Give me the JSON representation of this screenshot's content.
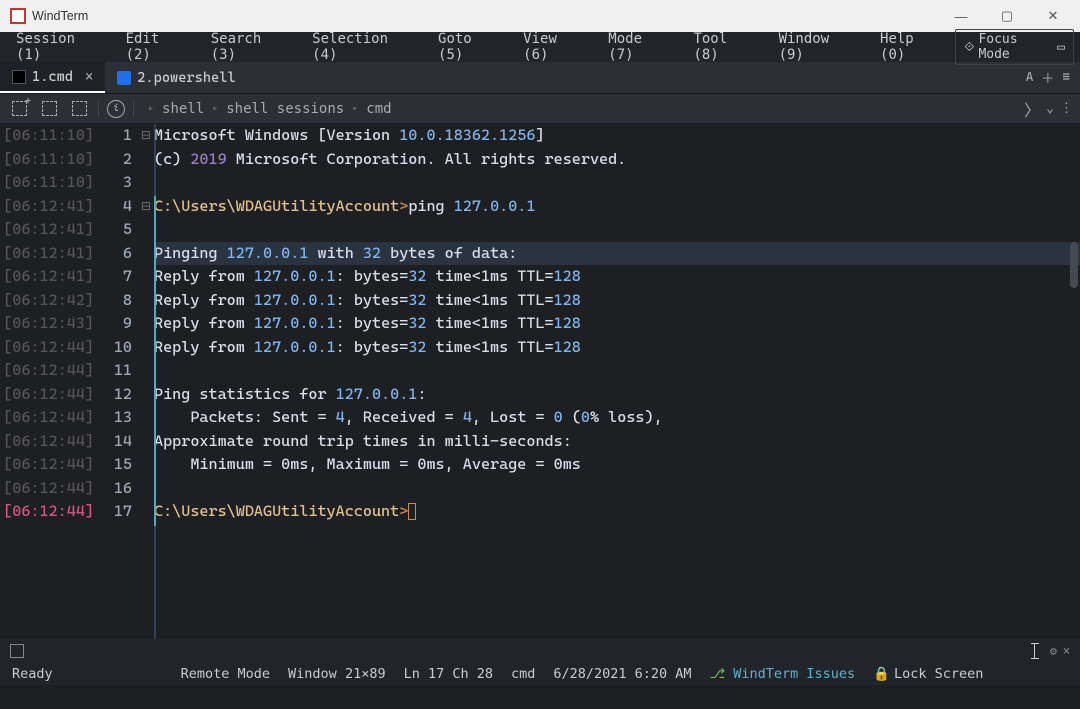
{
  "titlebar": {
    "title": "WindTerm"
  },
  "menu": {
    "session": "Session (1)",
    "edit": "Edit (2)",
    "search": "Search (3)",
    "selection": "Selection (4)",
    "goto": "Goto (5)",
    "view": "View (6)",
    "mode": "Mode (7)",
    "tool": "Tool (8)",
    "window": "Window (9)",
    "help": "Help (0)",
    "focusmode": "Focus Mode"
  },
  "tabs": {
    "t1": "1.cmd",
    "t2": "2.powershell",
    "aa": "A"
  },
  "crumbs": {
    "a": "shell",
    "b": "shell sessions",
    "c": "cmd"
  },
  "lines": [
    {
      "ts": "[06:11:10]",
      "n": "1",
      "fold": "⊟",
      "seg": [
        [
          "kw",
          "Microsoft Windows [Version "
        ],
        [
          "ver",
          "10.0.18362.1256"
        ],
        [
          "kw",
          "]"
        ]
      ]
    },
    {
      "ts": "[06:11:10]",
      "n": "2",
      "fold": "",
      "seg": [
        [
          "kw",
          "(c) "
        ],
        [
          "year",
          "2019"
        ],
        [
          "kw",
          " Microsoft Corporation. All rights reserved."
        ]
      ]
    },
    {
      "ts": "[06:11:10]",
      "n": "3",
      "fold": "",
      "seg": []
    },
    {
      "ts": "[06:12:41]",
      "n": "4",
      "fold": "⊟",
      "seg": [
        [
          "path",
          "C:\\Users\\WDAGUtilityAccount"
        ],
        [
          "op",
          ">"
        ],
        [
          "kw",
          "ping "
        ],
        [
          "ip",
          "127.0.0.1"
        ]
      ]
    },
    {
      "ts": "[06:12:41]",
      "n": "5",
      "fold": "",
      "seg": []
    },
    {
      "ts": "[06:12:41]",
      "n": "6",
      "fold": "",
      "hl": true,
      "seg": [
        [
          "kw",
          "Pinging "
        ],
        [
          "ip",
          "127.0.0.1"
        ],
        [
          "kw",
          " with "
        ],
        [
          "num",
          "32"
        ],
        [
          "kw",
          " bytes of data:"
        ]
      ]
    },
    {
      "ts": "[06:12:41]",
      "n": "7",
      "fold": "",
      "seg": [
        [
          "kw",
          "Reply from "
        ],
        [
          "ip",
          "127.0.0.1"
        ],
        [
          "kw",
          ": bytes="
        ],
        [
          "num",
          "32"
        ],
        [
          "kw",
          " time<1ms TTL="
        ],
        [
          "num",
          "128"
        ]
      ]
    },
    {
      "ts": "[06:12:42]",
      "n": "8",
      "fold": "",
      "seg": [
        [
          "kw",
          "Reply from "
        ],
        [
          "ip",
          "127.0.0.1"
        ],
        [
          "kw",
          ": bytes="
        ],
        [
          "num",
          "32"
        ],
        [
          "kw",
          " time<1ms TTL="
        ],
        [
          "num",
          "128"
        ]
      ]
    },
    {
      "ts": "[06:12:43]",
      "n": "9",
      "fold": "",
      "seg": [
        [
          "kw",
          "Reply from "
        ],
        [
          "ip",
          "127.0.0.1"
        ],
        [
          "kw",
          ": bytes="
        ],
        [
          "num",
          "32"
        ],
        [
          "kw",
          " time<1ms TTL="
        ],
        [
          "num",
          "128"
        ]
      ]
    },
    {
      "ts": "[06:12:44]",
      "n": "10",
      "fold": "",
      "seg": [
        [
          "kw",
          "Reply from "
        ],
        [
          "ip",
          "127.0.0.1"
        ],
        [
          "kw",
          ": bytes="
        ],
        [
          "num",
          "32"
        ],
        [
          "kw",
          " time<1ms TTL="
        ],
        [
          "num",
          "128"
        ]
      ]
    },
    {
      "ts": "[06:12:44]",
      "n": "11",
      "fold": "",
      "seg": []
    },
    {
      "ts": "[06:12:44]",
      "n": "12",
      "fold": "",
      "seg": [
        [
          "kw",
          "Ping statistics for "
        ],
        [
          "ip",
          "127.0.0.1"
        ],
        [
          "kw",
          ":"
        ]
      ]
    },
    {
      "ts": "[06:12:44]",
      "n": "13",
      "fold": "",
      "seg": [
        [
          "kw",
          "    Packets: Sent = "
        ],
        [
          "num",
          "4"
        ],
        [
          "kw",
          ", Received = "
        ],
        [
          "num",
          "4"
        ],
        [
          "kw",
          ", Lost = "
        ],
        [
          "num",
          "0"
        ],
        [
          "kw",
          " ("
        ],
        [
          "num",
          "0"
        ],
        [
          "kw",
          "% loss),"
        ]
      ]
    },
    {
      "ts": "[06:12:44]",
      "n": "14",
      "fold": "",
      "seg": [
        [
          "kw",
          "Approximate round trip times in milli-seconds:"
        ]
      ]
    },
    {
      "ts": "[06:12:44]",
      "n": "15",
      "fold": "",
      "seg": [
        [
          "kw",
          "    Minimum = 0ms, Maximum = 0ms, Average = 0ms"
        ]
      ]
    },
    {
      "ts": "[06:12:44]",
      "n": "16",
      "fold": "",
      "seg": []
    },
    {
      "ts": "[06:12:44]",
      "n": "17",
      "fold": "",
      "hot": true,
      "seg": [
        [
          "path",
          "C:\\Users\\WDAGUtilityAccount"
        ],
        [
          "op",
          ">"
        ],
        [
          "cursor",
          ""
        ]
      ]
    }
  ],
  "status": {
    "ready": "Ready",
    "mode": "Remote Mode",
    "win": "Window 21×89",
    "pos": "Ln 17 Ch 28",
    "shell": "cmd",
    "date": "6/28/2021 6:20 AM",
    "issues": "WindTerm Issues",
    "lock": "Lock Screen"
  }
}
